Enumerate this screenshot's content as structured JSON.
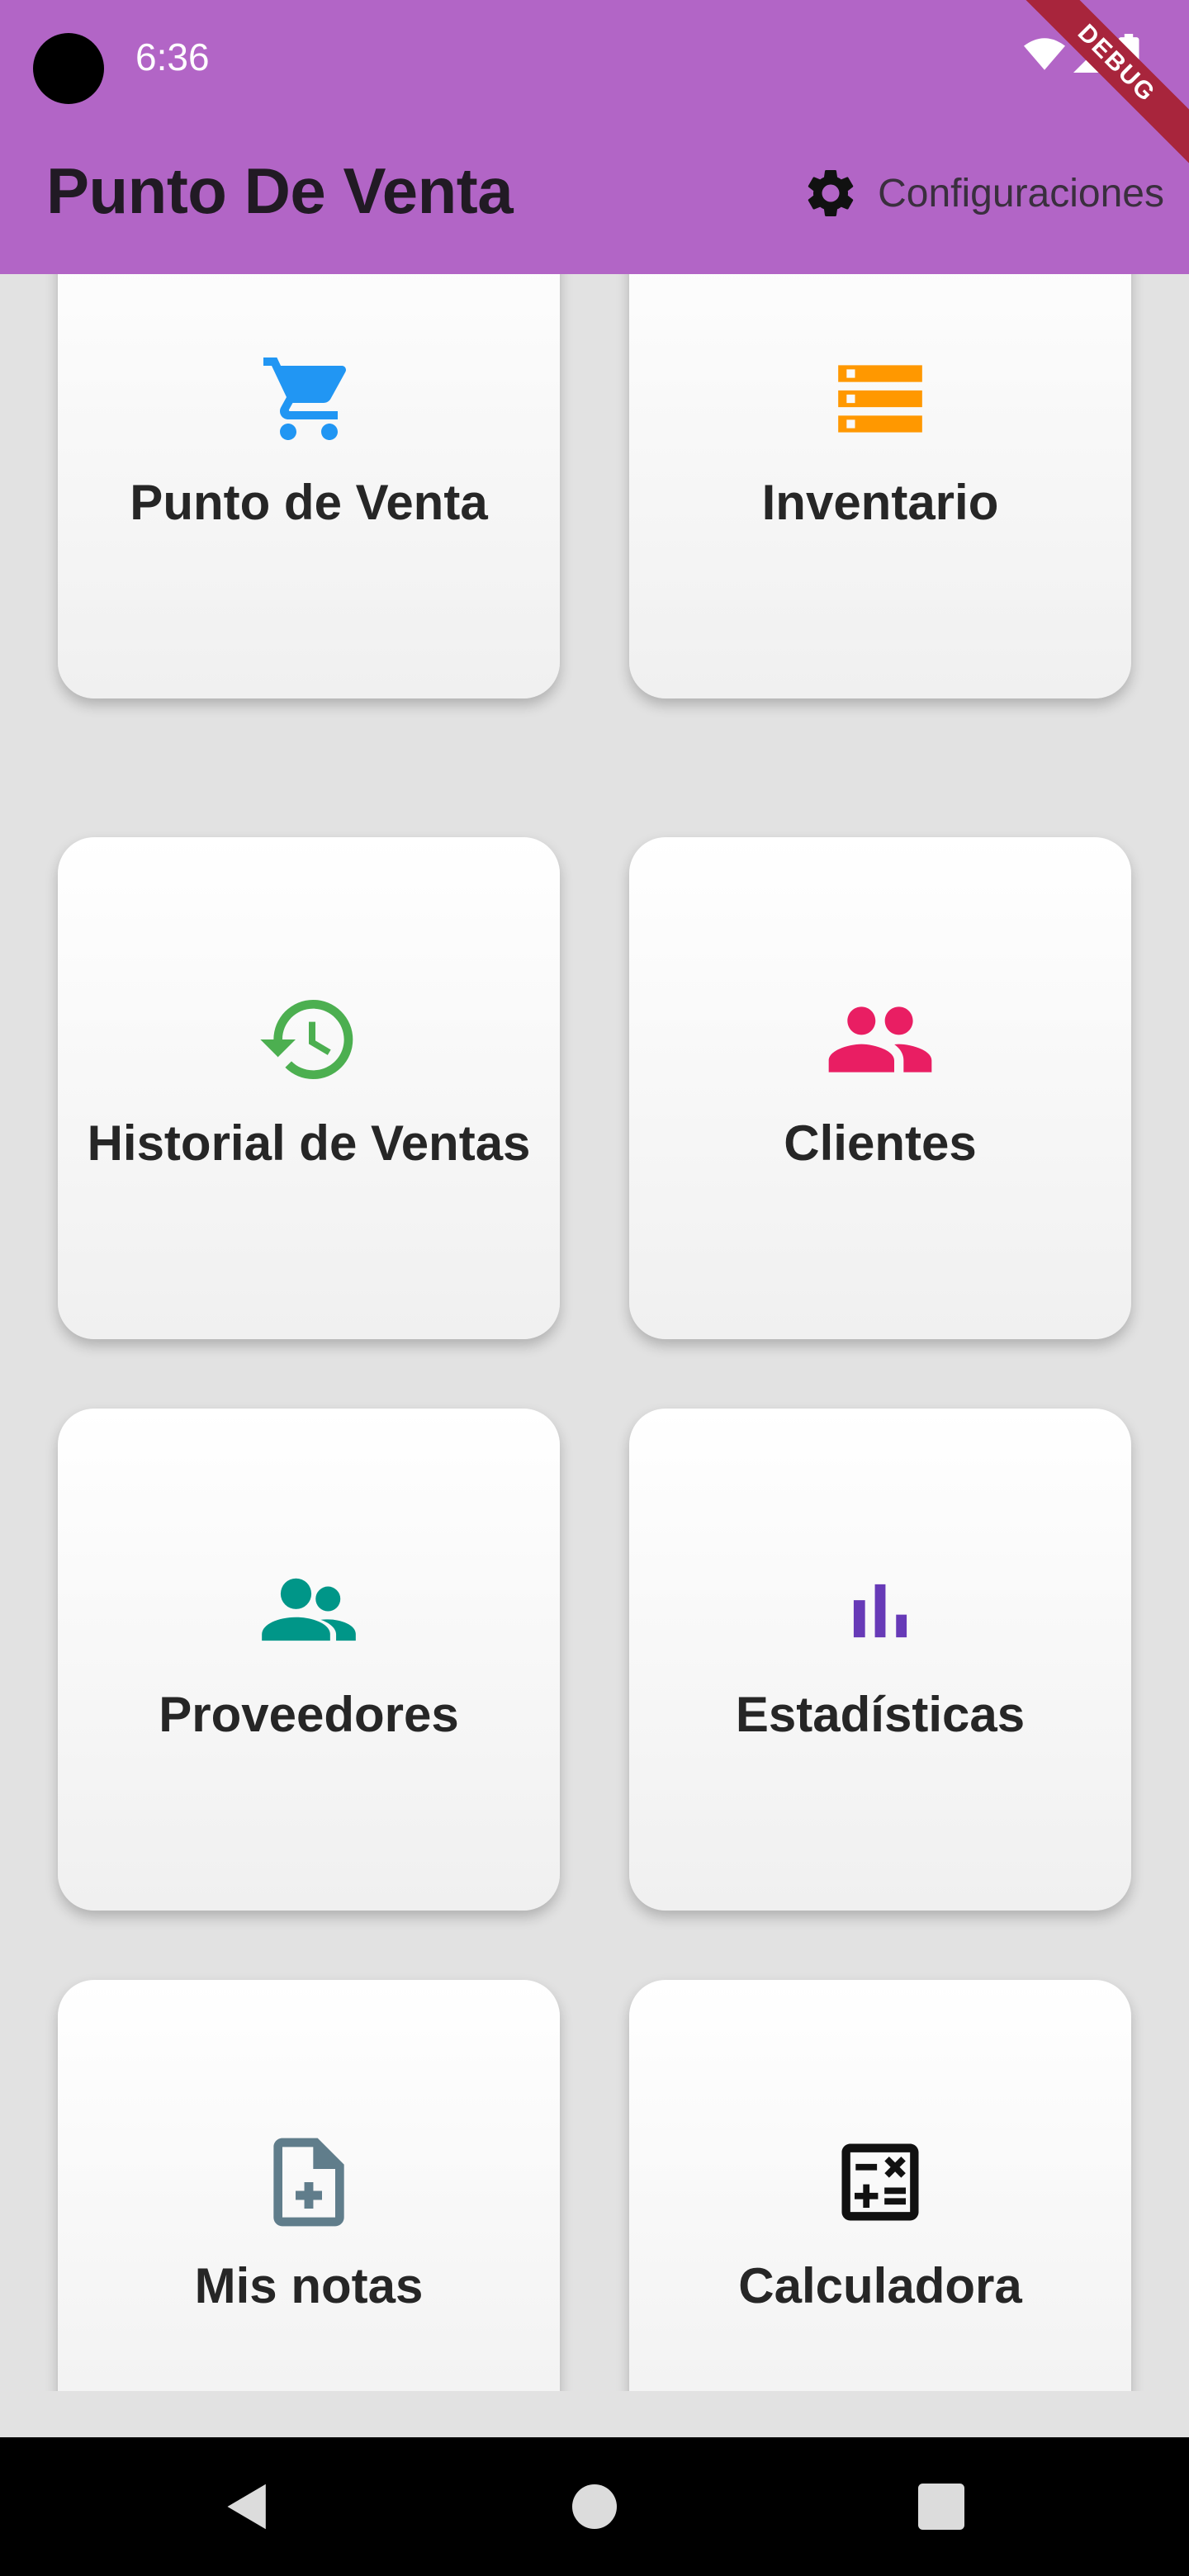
{
  "status_bar": {
    "time": "6:36",
    "debug_banner": "DEBUG"
  },
  "app_bar": {
    "title": "Punto De Venta",
    "settings_label": "Configuraciones",
    "background": "#b265c6"
  },
  "menu": [
    {
      "label": "Punto de Venta",
      "icon": "shopping-cart-icon",
      "color": "#2196f3"
    },
    {
      "label": "Inventario",
      "icon": "inventory-list-icon",
      "color": "#ff9800"
    },
    {
      "label": "Historial de Ventas",
      "icon": "history-icon",
      "color": "#4caf50"
    },
    {
      "label": "Clientes",
      "icon": "people-icon",
      "color": "#e91e63"
    },
    {
      "label": "Proveedores",
      "icon": "suppliers-icon",
      "color": "#009688"
    },
    {
      "label": "Estadísticas",
      "icon": "bar-chart-icon",
      "color": "#673ab7"
    },
    {
      "label": "Mis notas",
      "icon": "note-add-icon",
      "color": "#607d8b"
    },
    {
      "label": "Calculadora",
      "icon": "calculator-icon",
      "color": "#111111"
    }
  ],
  "nav_bar": {
    "back": "back-icon",
    "home": "home-icon",
    "recents": "recents-icon"
  }
}
